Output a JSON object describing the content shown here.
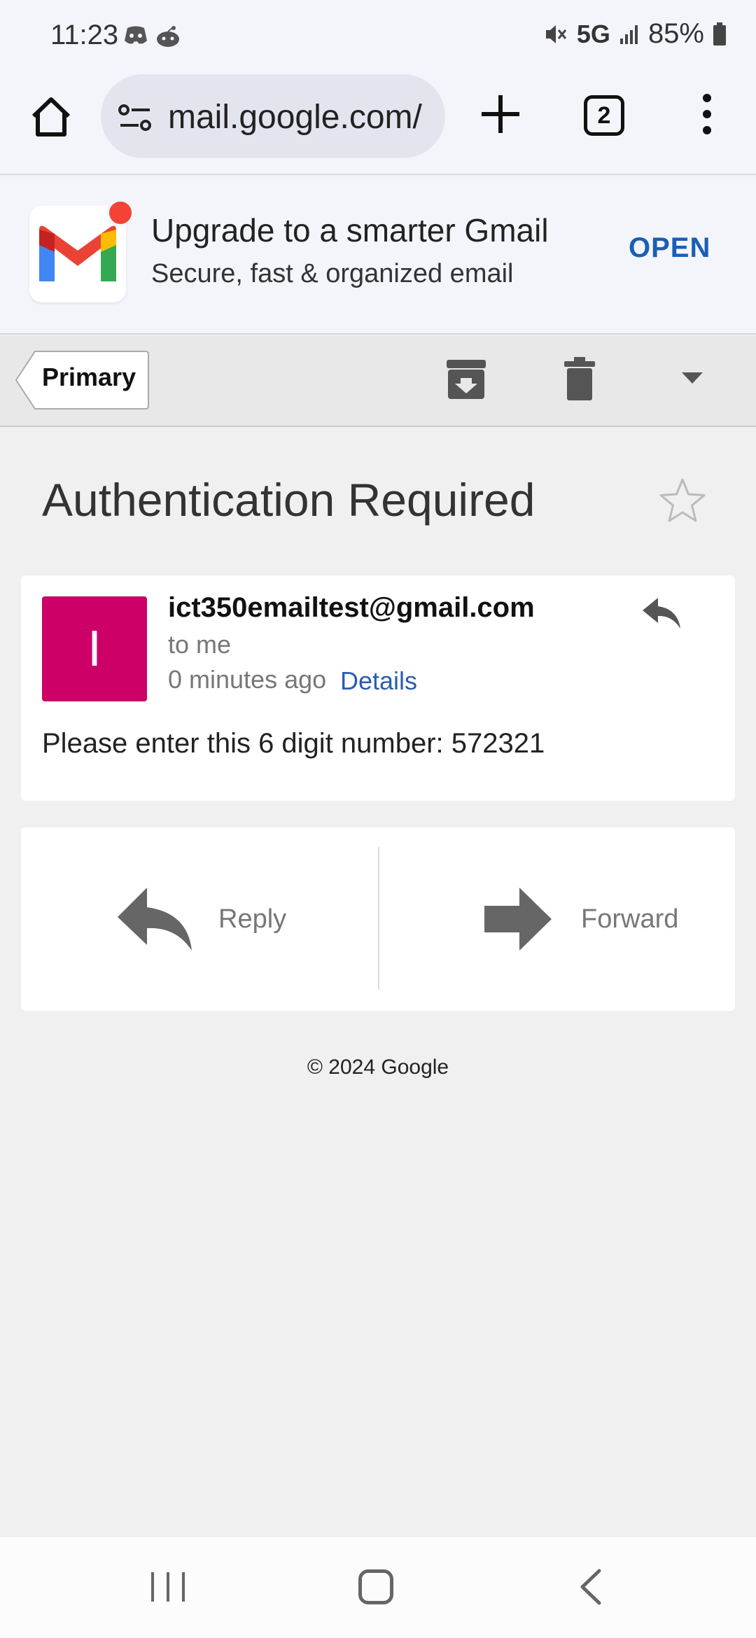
{
  "status_bar": {
    "time": "11:23",
    "network": "5G",
    "battery": "85%"
  },
  "browser": {
    "url": "mail.google.com/",
    "tab_count": "2"
  },
  "banner": {
    "title": "Upgrade to a smarter Gmail",
    "subtitle": "Secure, fast & organized email",
    "open_label": "OPEN"
  },
  "actionbar": {
    "back_label": "Primary"
  },
  "email": {
    "subject": "Authentication Required",
    "avatar_letter": "I",
    "sender": "ict350emailtest@gmail.com",
    "recipient": "to me",
    "time": "0 minutes ago",
    "details_label": "Details",
    "body": "Please enter this 6 digit number: 572321"
  },
  "actions": {
    "reply_label": "Reply",
    "forward_label": "Forward"
  },
  "footer": {
    "copyright": "© 2024 Google"
  },
  "colors": {
    "avatar": "#cc0066",
    "link": "#2a5db0",
    "open": "#1a5fb4",
    "notification": "#f44336"
  }
}
